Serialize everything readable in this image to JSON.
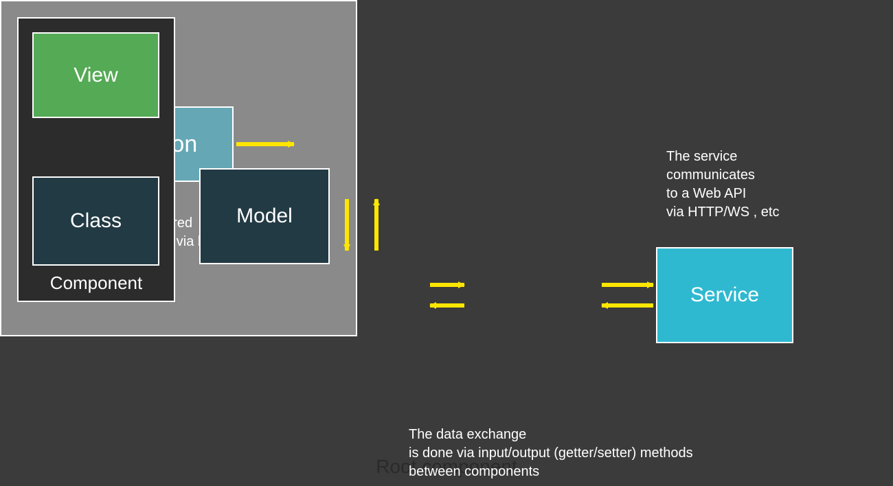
{
  "boxes": {
    "action": "Action",
    "view": "View",
    "class": "Class",
    "component": "Component",
    "model": "Model",
    "root": "Root component",
    "service": "Service"
  },
  "captions": {
    "events": "Events are fired\nand updated via bindings",
    "service": "The service\ncommunicates\nto a  Web API\nvia HTTP/WS , etc",
    "data": "The data exchange\nis done via input/output (getter/setter) methods\nbetween components"
  },
  "colors": {
    "bg": "#3b3b3b",
    "action": "#65a7b5",
    "root": "#8a8a8a",
    "component_dark": "#2c2c2c",
    "view": "#55aa55",
    "class_model": "#223a44",
    "service": "#2fb9d1",
    "arrow": "#ffe600"
  },
  "arrows": [
    {
      "from": "action",
      "to": "view",
      "dir": "right"
    },
    {
      "from": "view",
      "to": "class",
      "dir": "both-vertical"
    },
    {
      "from": "class",
      "to": "model",
      "dir": "both-horizontal"
    },
    {
      "from": "model",
      "to": "service",
      "dir": "both-horizontal"
    }
  ]
}
